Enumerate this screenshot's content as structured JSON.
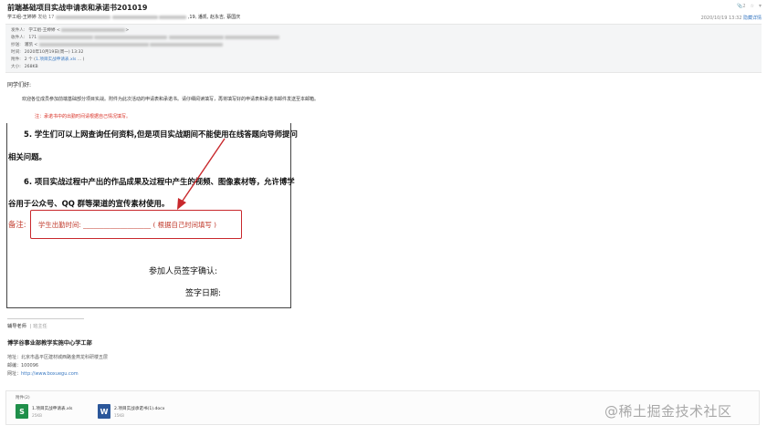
{
  "subject": "前端基础项目实战申请表和承诺书201019",
  "sender": {
    "name": "学工组-王婷婷",
    "to_prefix": "发给 17",
    "to_suffix": ",19, 潘凯, 赵永吉, 蔡国庆"
  },
  "topbar": {
    "attachment_count": "2",
    "star": "☆",
    "dropdown": "▾"
  },
  "meta": {
    "datetime": "2020/10/19 13:32",
    "detail_link": "隐藏详情"
  },
  "header": {
    "from_label": "发件人:",
    "from_value": "学工组-王婷婷 <",
    "to_label": "收件人:",
    "to_value": "171",
    "cc_label": "抄送:",
    "cc_value": "潘凯 <",
    "time_label": "时间:",
    "time_value": "2020年10月19日(周一) 13:32",
    "attach_label": "附件:",
    "attach_value": "2 个 (",
    "attach_file": "1.项目实战申请表.xls",
    "size_label": "大小:",
    "size_value": "268KB"
  },
  "body": {
    "greeting": "同学们好:",
    "intro": "欢迎各位成员参加前端基础部分项目实战。附件为此次活动的申请表和承诺书。请仔细阅读填写，再将填写好的申请表和承诺书邮件发送至本邮箱。",
    "note": "注：承诺书中的出勤时间请根据自己情况填写。"
  },
  "document": {
    "p5_line1": "5.  学生们可以上网查询任何资料,但是项目实战期间不能使用在线答题向导师提问",
    "p5_line2": "相关问题。",
    "p6_line1": "6.  项目实战过程中产出的作品成果及过程中产生的视频、图像素材等，允许博学",
    "p6_line2": "谷用于公众号、QQ 群等渠道的宣传素材使用。",
    "remark_label": "备注:",
    "remark_text": "学生出勤时间: ____________________ ( 根据自己时间填写 )",
    "confirm": "参加人员签字确认:",
    "sign_date": "签字日期:"
  },
  "signature": {
    "teacher": "辅导老师",
    "teacher_sub": "| 班主任",
    "dept": "博学谷事业部教学实施中心学工部",
    "address": "地址：北京市昌平区建材城西路金燕龙科研楼五层",
    "postcode": "邮编：100096",
    "site_label": "网址：",
    "site_url": "http://www.boxuegu.com"
  },
  "attachments": {
    "title": "附件(2)",
    "files": [
      {
        "name": "1.项目实战申请表.xls",
        "size": "25KB",
        "icon": "spreadsheet-icon"
      },
      {
        "name": "2.项目实战承诺书(1).docx",
        "size": "15KB",
        "icon": "word-icon"
      }
    ]
  },
  "watermark": "@稀土掘金技术社区",
  "colors": {
    "accent_red": "#c8282c",
    "link_blue": "#3a79c2",
    "header_bg": "#f4f5f6"
  }
}
